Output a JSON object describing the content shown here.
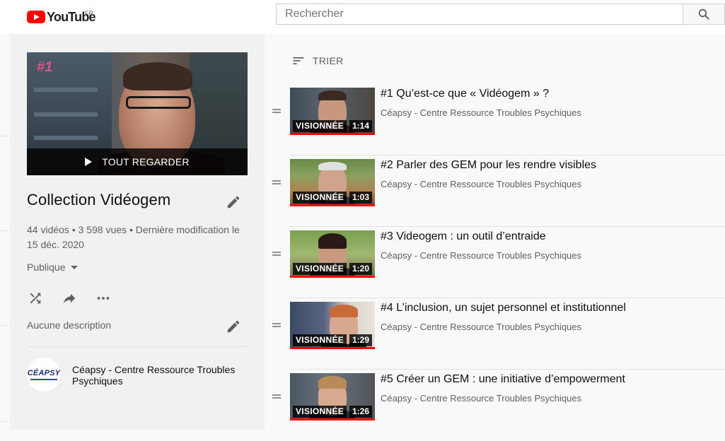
{
  "header": {
    "logo_text": "YouTube",
    "country_code": "FR",
    "search_placeholder": "Rechercher"
  },
  "playlist": {
    "hero_label": "TOUT REGARDER",
    "hero_number": "#1",
    "title": "Collection Vidéogem",
    "stats": "44 vidéos • 3 598 vues • Dernière modification le 15 déc. 2020",
    "privacy": "Publique",
    "description": "Aucune description",
    "owner_avatar_text": "CÉAPSY",
    "owner_name": "Céapsy - Centre Ressource Troubles Psychiques"
  },
  "sort_label": "TRIER",
  "watched_label": "VISIONNÉE",
  "videos": [
    {
      "title": "#1 Qu’est-ce que « Vidéogem » ?",
      "channel": "Céapsy - Centre Ressource Troubles Psychiques",
      "duration": "1:14",
      "progress": 1.0
    },
    {
      "title": "#2 Parler des GEM pour les rendre visibles",
      "channel": "Céapsy - Centre Ressource Troubles Psychiques",
      "duration": "1:03",
      "progress": 1.0
    },
    {
      "title": "#3 Videogem : un outil d’entraide",
      "channel": "Céapsy - Centre Ressource Troubles Psychiques",
      "duration": "1:20",
      "progress": 1.0
    },
    {
      "title": "#4 L’inclusion, un sujet personnel et institutionnel",
      "channel": "Céapsy - Centre Ressource Troubles Psychiques",
      "duration": "1:29",
      "progress": 1.0
    },
    {
      "title": "#5 Créer un GEM : une initiative d’empowerment",
      "channel": "Céapsy - Centre Ressource Troubles Psychiques",
      "duration": "1:26",
      "progress": 1.0
    }
  ],
  "colors": {
    "brand_red": "#ff0000",
    "sidebar_bg": "#f1f1f1",
    "text_secondary": "#606060"
  },
  "icons": [
    "youtube-logo-icon",
    "search-icon",
    "pencil-icon",
    "shuffle-icon",
    "share-icon",
    "more-icon",
    "sort-icon",
    "drag-handle-icon",
    "play-icon"
  ]
}
